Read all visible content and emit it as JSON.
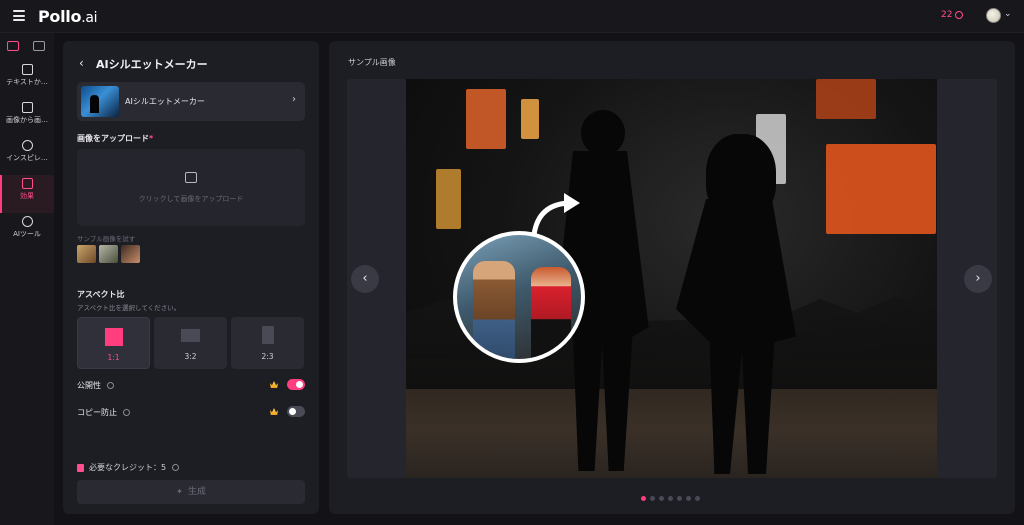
{
  "app": {
    "logo": "Pollo",
    "logo_suffix": ".ai",
    "credits": "22",
    "icons": {
      "menu": "hamburger-icon",
      "credit": "coin-icon",
      "profile": "avatar"
    }
  },
  "sidebar": {
    "tabs": [
      {
        "icon": "image-icon"
      },
      {
        "icon": "video-icon"
      }
    ],
    "items": [
      {
        "label": "テキストか…",
        "icon": "text-to-image-icon"
      },
      {
        "label": "画像から画…",
        "icon": "image-to-image-icon"
      },
      {
        "label": "インスピレ…",
        "icon": "compass-icon"
      },
      {
        "label": "効果",
        "icon": "effects-icon",
        "active": true
      },
      {
        "label": "AIツール",
        "icon": "ai-tools-icon"
      }
    ]
  },
  "panel": {
    "title": "AIシルエットメーカー",
    "model": {
      "name": "AIシルエットメーカー"
    },
    "upload": {
      "label": "画像をアップロード",
      "required_mark": "*",
      "hint": "クリックして画像をアップロード"
    },
    "samples": {
      "label": "サンプル画像を試す"
    },
    "aspect": {
      "label": "アスペクト比",
      "subtitle": "アスペクト比を選択してください。",
      "options": [
        {
          "label": "1:1",
          "selected": true
        },
        {
          "label": "3:2",
          "selected": false
        },
        {
          "label": "2:3",
          "selected": false
        }
      ]
    },
    "options": [
      {
        "label": "公開性",
        "enabled": true
      },
      {
        "label": "コピー防止",
        "enabled": false
      }
    ],
    "cost": {
      "label": "必要なクレジット：",
      "value": "5"
    },
    "generate": {
      "label": "生成"
    }
  },
  "preview": {
    "label": "サンプル画像",
    "slide_count": 7,
    "active_slide": 1
  },
  "colors": {
    "accent": "#ff3d7f",
    "background": "#121217",
    "panel": "#1d1d24"
  }
}
